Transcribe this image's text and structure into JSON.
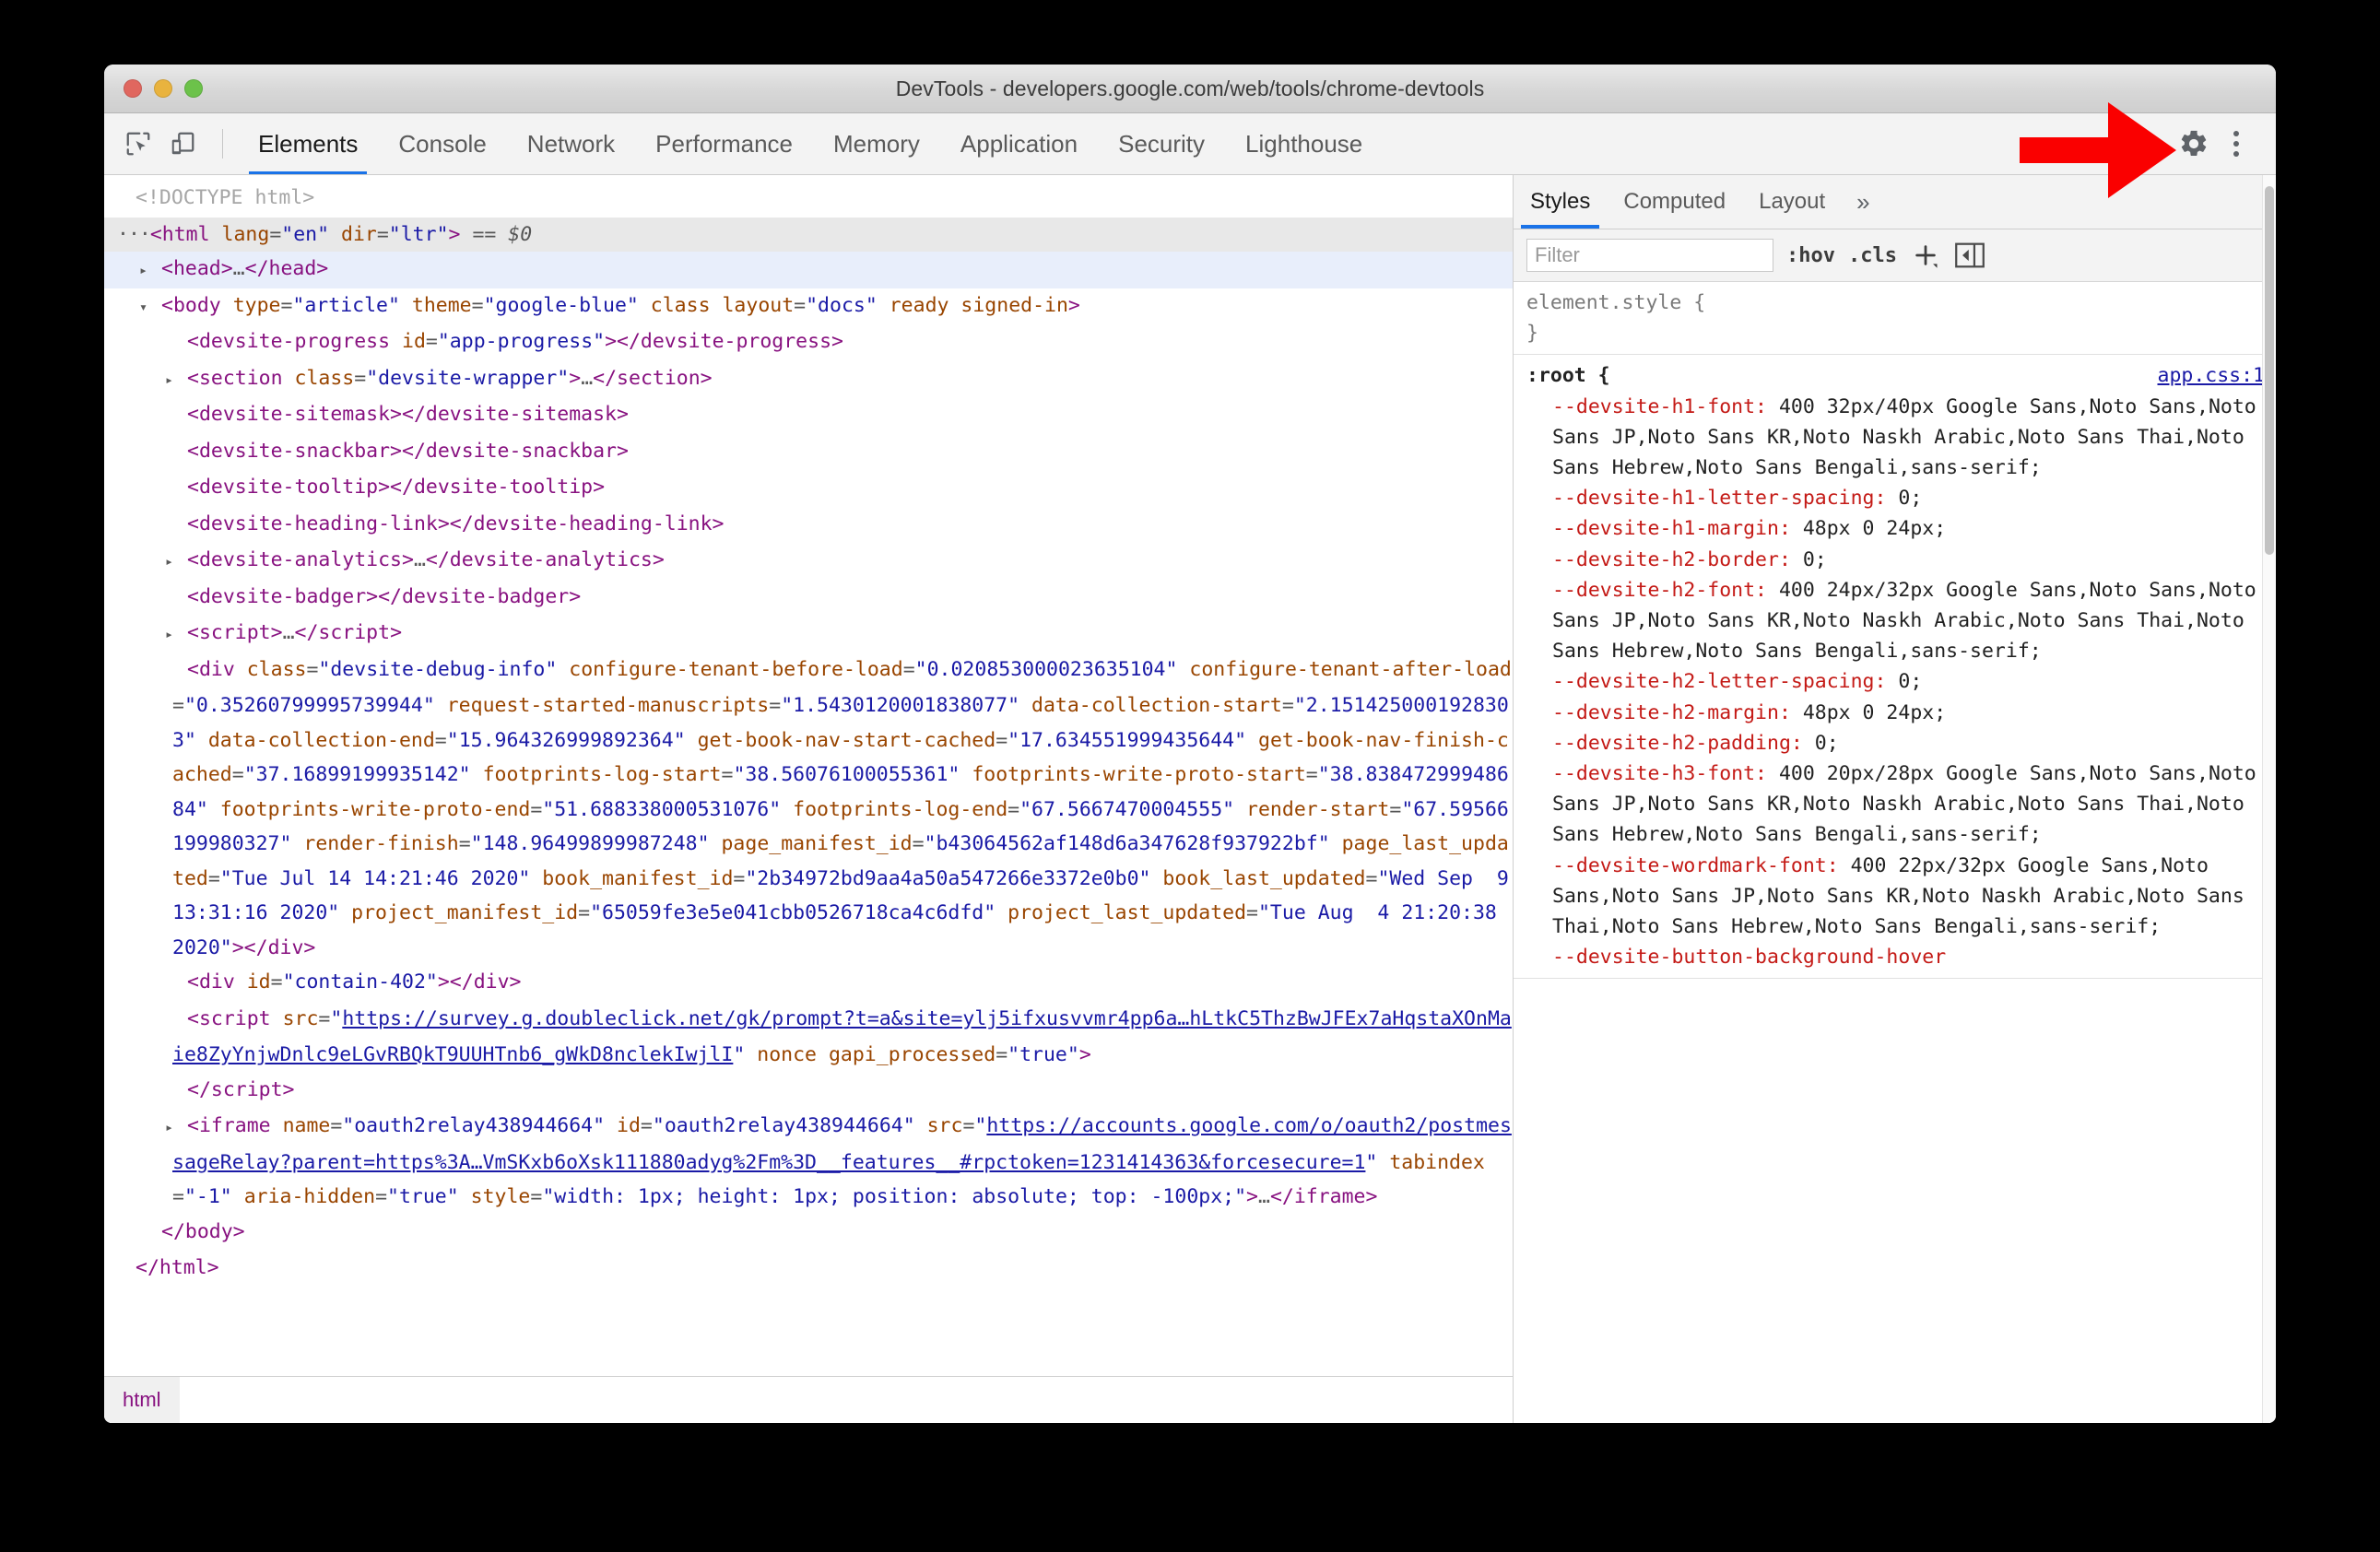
{
  "window": {
    "title": "DevTools - developers.google.com/web/tools/chrome-devtools",
    "traffic_lights": [
      "close",
      "minimize",
      "zoom"
    ]
  },
  "toolbar": {
    "inspect_icon": "inspect-element-icon",
    "device_icon": "device-toolbar-icon",
    "settings_icon": "gear-icon",
    "more_icon": "kebab-menu-icon",
    "tabs": [
      {
        "label": "Elements",
        "active": true
      },
      {
        "label": "Console",
        "active": false
      },
      {
        "label": "Network",
        "active": false
      },
      {
        "label": "Performance",
        "active": false
      },
      {
        "label": "Memory",
        "active": false
      },
      {
        "label": "Application",
        "active": false
      },
      {
        "label": "Security",
        "active": false
      },
      {
        "label": "Lighthouse",
        "active": false
      }
    ]
  },
  "annotation": {
    "arrow": "red-right-arrow",
    "arrow_color": "#fa0000",
    "points_to": "gear-icon"
  },
  "dom_tree": {
    "breadcrumb": [
      "html"
    ],
    "lines": [
      {
        "id": "l1",
        "indent": 0,
        "twisty": "none",
        "state": "",
        "html": "<span class='c-doctype'>&lt;!DOCTYPE html&gt;</span>"
      },
      {
        "id": "l2",
        "indent": 0,
        "twisty": "dots",
        "state": "sel-dark",
        "html": "<span class='c-tag'>&lt;html</span> <span class='c-attr'>lang</span><span class='c-gray'>=</span><span class='c-val'>\"en\"</span> <span class='c-attr'>dir</span><span class='c-gray'>=</span><span class='c-val'>\"ltr\"</span><span class='c-tag'>&gt;</span> <span class='c-gray'>==</span> <span class='c-eq'>$0</span>"
      },
      {
        "id": "l3",
        "indent": 1,
        "twisty": "right",
        "state": "sel-blue",
        "html": "<span class='c-tag'>&lt;head&gt;</span><span class='c-ell'>…</span><span class='c-tag'>&lt;/head&gt;</span>"
      },
      {
        "id": "l4",
        "indent": 1,
        "twisty": "down",
        "state": "",
        "html": "<span class='c-tag'>&lt;body</span> <span class='c-attr'>type</span><span class='c-gray'>=</span><span class='c-val'>\"article\"</span> <span class='c-attr'>theme</span><span class='c-gray'>=</span><span class='c-val'>\"google-blue\"</span> <span class='c-attr'>class</span> <span class='c-attr'>layout</span><span class='c-gray'>=</span><span class='c-val'>\"docs\"</span> <span class='c-attr'>ready</span> <span class='c-attr'>signed-in</span><span class='c-tag'>&gt;</span>"
      },
      {
        "id": "l5",
        "indent": 2,
        "twisty": "none",
        "state": "",
        "html": "<span class='c-tag'>&lt;devsite-progress</span> <span class='c-attr'>id</span><span class='c-gray'>=</span><span class='c-val'>\"app-progress\"</span><span class='c-tag'>&gt;&lt;/devsite-progress&gt;</span>"
      },
      {
        "id": "l6",
        "indent": 2,
        "twisty": "right",
        "state": "",
        "html": "<span class='c-tag'>&lt;section</span> <span class='c-attr'>class</span><span class='c-gray'>=</span><span class='c-val'>\"devsite-wrapper\"</span><span class='c-tag'>&gt;</span><span class='c-ell'>…</span><span class='c-tag'>&lt;/section&gt;</span>"
      },
      {
        "id": "l7",
        "indent": 2,
        "twisty": "none",
        "state": "",
        "html": "<span class='c-tag'>&lt;devsite-sitemask&gt;&lt;/devsite-sitemask&gt;</span>"
      },
      {
        "id": "l8",
        "indent": 2,
        "twisty": "none",
        "state": "",
        "html": "<span class='c-tag'>&lt;devsite-snackbar&gt;&lt;/devsite-snackbar&gt;</span>"
      },
      {
        "id": "l9",
        "indent": 2,
        "twisty": "none",
        "state": "",
        "html": "<span class='c-tag'>&lt;devsite-tooltip&gt;&lt;/devsite-tooltip&gt;</span>"
      },
      {
        "id": "l10",
        "indent": 2,
        "twisty": "none",
        "state": "",
        "html": "<span class='c-tag'>&lt;devsite-heading-link&gt;&lt;/devsite-heading-link&gt;</span>"
      },
      {
        "id": "l11",
        "indent": 2,
        "twisty": "right",
        "state": "",
        "html": "<span class='c-tag'>&lt;devsite-analytics&gt;</span><span class='c-ell'>…</span><span class='c-tag'>&lt;/devsite-analytics&gt;</span>"
      },
      {
        "id": "l12",
        "indent": 2,
        "twisty": "none",
        "state": "",
        "html": "<span class='c-tag'>&lt;devsite-badger&gt;&lt;/devsite-badger&gt;</span>"
      },
      {
        "id": "l13",
        "indent": 2,
        "twisty": "right",
        "state": "",
        "html": "<span class='c-tag'>&lt;script&gt;</span><span class='c-ell'>…</span><span class='c-tag'>&lt;/script&gt;</span>"
      },
      {
        "id": "l14",
        "indent": 2,
        "twisty": "none",
        "state": "",
        "html": "<span class='c-tag'>&lt;div</span> <span class='c-attr'>class</span><span class='c-gray'>=</span><span class='c-val'>\"devsite-debug-info\"</span> <span class='c-attr'>configure-tenant-before-load</span><span class='c-gray'>=</span><span class='c-val'>\"0.020853000023635104\"</span> <span class='c-attr'>configure-tenant-after-load</span><span class='c-gray'>=</span><span class='c-val'>\"0.35260799995739944\"</span> <span class='c-attr'>request-started-manuscripts</span><span class='c-gray'>=</span><span class='c-val'>\"1.5430120001838077\"</span> <span class='c-attr'>data-collection-start</span><span class='c-gray'>=</span><span class='c-val'>\"2.1514250001928303\"</span> <span class='c-attr'>data-collection-end</span><span class='c-gray'>=</span><span class='c-val'>\"15.964326999892364\"</span> <span class='c-attr'>get-book-nav-start-cached</span><span class='c-gray'>=</span><span class='c-val'>\"17.634551999435644\"</span> <span class='c-attr'>get-book-nav-finish-cached</span><span class='c-gray'>=</span><span class='c-val'>\"37.16899199935142\"</span> <span class='c-attr'>footprints-log-start</span><span class='c-gray'>=</span><span class='c-val'>\"38.56076100055361\"</span> <span class='c-attr'>footprints-write-proto-start</span><span class='c-gray'>=</span><span class='c-val'>\"38.83847299948684\"</span> <span class='c-attr'>footprints-write-proto-end</span><span class='c-gray'>=</span><span class='c-val'>\"51.688338000531076\"</span> <span class='c-attr'>footprints-log-end</span><span class='c-gray'>=</span><span class='c-val'>\"67.5667470004555\"</span> <span class='c-attr'>render-start</span><span class='c-gray'>=</span><span class='c-val'>\"67.59566199980327\"</span> <span class='c-attr'>render-finish</span><span class='c-gray'>=</span><span class='c-val'>\"148.96499899987248\"</span> <span class='c-attr'>page_manifest_id</span><span class='c-gray'>=</span><span class='c-val'>\"b43064562af148d6a347628f937922bf\"</span> <span class='c-attr'>page_last_updated</span><span class='c-gray'>=</span><span class='c-val'>\"Tue Jul 14 14:21:46 2020\"</span> <span class='c-attr'>book_manifest_id</span><span class='c-gray'>=</span><span class='c-val'>\"2b34972bd9aa4a50a547266e3372e0b0\"</span> <span class='c-attr'>book_last_updated</span><span class='c-gray'>=</span><span class='c-val'>\"Wed Sep  9 13:31:16 2020\"</span> <span class='c-attr'>project_manifest_id</span><span class='c-gray'>=</span><span class='c-val'>\"65059fe3e5e041cbb0526718ca4c6dfd\"</span> <span class='c-attr'>project_last_updated</span><span class='c-gray'>=</span><span class='c-val'>\"Tue Aug  4 21:20:38 2020\"</span><span class='c-tag'>&gt;&lt;/div&gt;</span>"
      },
      {
        "id": "l15",
        "indent": 2,
        "twisty": "none",
        "state": "",
        "html": "<span class='c-tag'>&lt;div</span> <span class='c-attr'>id</span><span class='c-gray'>=</span><span class='c-val'>\"contain-402\"</span><span class='c-tag'>&gt;&lt;/div&gt;</span>"
      },
      {
        "id": "l16",
        "indent": 2,
        "twisty": "none",
        "state": "",
        "html": "<span class='c-tag'>&lt;script</span> <span class='c-attr'>src</span><span class='c-gray'>=</span><span class='c-val'>\"</span><span class='c-link'>https://survey.g.doubleclick.net/gk/prompt?t=a&amp;site=ylj5ifxusvvmr4pp6a…hLtkC5ThzBwJFEx7aHqstaXOnMaie8ZyYnjwDnlc9eLGvRBQkT9UUHTnb6_gWkD8nclekIwjlI</span><span class='c-val'>\"</span> <span class='c-attr'>nonce</span> <span class='c-attr'>gapi_processed</span><span class='c-gray'>=</span><span class='c-val'>\"true\"</span><span class='c-tag'>&gt;</span>"
      },
      {
        "id": "l17",
        "indent": 2,
        "twisty": "none",
        "state": "",
        "html": "<span class='c-tag'>&lt;/script&gt;</span>"
      },
      {
        "id": "l18",
        "indent": 2,
        "twisty": "right",
        "state": "",
        "html": "<span class='c-tag'>&lt;iframe</span> <span class='c-attr'>name</span><span class='c-gray'>=</span><span class='c-val'>\"oauth2relay438944664\"</span> <span class='c-attr'>id</span><span class='c-gray'>=</span><span class='c-val'>\"oauth2relay438944664\"</span> <span class='c-attr'>src</span><span class='c-gray'>=</span><span class='c-val'>\"</span><span class='c-link'>https://accounts.google.com/o/oauth2/postmessageRelay?parent=https%3A…VmSKxb6oXsk111880adyg%2Fm%3D__features__#rpctoken=1231414363&amp;forcesecure=1</span><span class='c-val'>\"</span> <span class='c-attr'>tabindex</span><span class='c-gray'>=</span><span class='c-val'>\"-1\"</span> <span class='c-attr'>aria-hidden</span><span class='c-gray'>=</span><span class='c-val'>\"true\"</span> <span class='c-attr'>style</span><span class='c-gray'>=</span><span class='c-val'>\"width: 1px; height: 1px; position: absolute; top: -100px;\"</span><span class='c-tag'>&gt;</span><span class='c-ell'>…</span><span class='c-tag'>&lt;/iframe&gt;</span>"
      },
      {
        "id": "l19",
        "indent": 1,
        "twisty": "none",
        "state": "",
        "html": "<span class='c-tag'>&lt;/body&gt;</span>"
      },
      {
        "id": "l20",
        "indent": 0,
        "twisty": "none",
        "state": "",
        "html": "<span class='c-tag'>&lt;/html&gt;</span>"
      }
    ]
  },
  "styles": {
    "tabs": [
      {
        "label": "Styles",
        "active": true
      },
      {
        "label": "Computed",
        "active": false
      },
      {
        "label": "Layout",
        "active": false
      },
      {
        "label": "»",
        "active": false
      }
    ],
    "filter_placeholder": "Filter",
    "hov_label": ":hov",
    "cls_label": ".cls",
    "new_rule_icon": "plus-icon",
    "toggle_sidebar_icon": "toggle-element-state-icon",
    "rules": [
      {
        "selector": "element.style {",
        "origin": "",
        "props": [],
        "close": "}"
      },
      {
        "selector": ":root {",
        "origin": "app.css:1",
        "close": "",
        "props": [
          {
            "name": "--devsite-h1-font",
            "value": "400 32px/40px Google Sans,Noto Sans,Noto Sans JP,Noto Sans KR,Noto Naskh Arabic,Noto Sans Thai,Noto Sans Hebrew,Noto Sans Bengali,sans-serif;"
          },
          {
            "name": "--devsite-h1-letter-spacing",
            "value": "0;"
          },
          {
            "name": "--devsite-h1-margin",
            "value": "48px 0 24px;"
          },
          {
            "name": "--devsite-h2-border",
            "value": "0;"
          },
          {
            "name": "--devsite-h2-font",
            "value": "400 24px/32px Google Sans,Noto Sans,Noto Sans JP,Noto Sans KR,Noto Naskh Arabic,Noto Sans Thai,Noto Sans Hebrew,Noto Sans Bengali,sans-serif;"
          },
          {
            "name": "--devsite-h2-letter-spacing",
            "value": "0;"
          },
          {
            "name": "--devsite-h2-margin",
            "value": "48px 0 24px;"
          },
          {
            "name": "--devsite-h2-padding",
            "value": "0;"
          },
          {
            "name": "--devsite-h3-font",
            "value": "400 20px/28px Google Sans,Noto Sans,Noto Sans JP,Noto Sans KR,Noto Naskh Arabic,Noto Sans Thai,Noto Sans Hebrew,Noto Sans Bengali,sans-serif;"
          },
          {
            "name": "--devsite-wordmark-font",
            "value": "400 22px/32px Google Sans,Noto Sans,Noto Sans JP,Noto Sans KR,Noto Naskh Arabic,Noto Sans Thai,Noto Sans Hebrew,Noto Sans Bengali,sans-serif;"
          },
          {
            "name": "--devsite-button-background-hover",
            "value": ""
          }
        ]
      }
    ]
  },
  "colors": {
    "accent": "#1a73e8",
    "tag": "#881280",
    "attr_name": "#994500",
    "attr_value": "#1a1aa6",
    "css_prop": "#c41a16",
    "arrow_red": "#fa0000"
  }
}
